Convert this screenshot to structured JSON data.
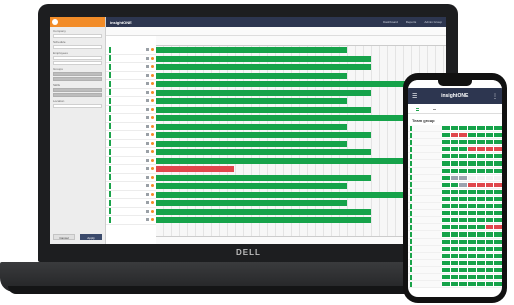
{
  "laptop": {
    "brand": "DELL",
    "left_panel": {
      "labels": [
        "Company",
        "Schedule",
        "Employees",
        "Groups",
        "Skills",
        "Location"
      ],
      "buttons": {
        "cancel": "Cancel",
        "apply": "Apply"
      }
    },
    "topbar": {
      "title": "insightONE",
      "links": [
        "Dashboard",
        "Reports",
        "Admin Group"
      ]
    },
    "rows": [
      {
        "bar": 0.66
      },
      {
        "bar": 0.74
      },
      {
        "bar": 0.74
      },
      {
        "bar": 0.66
      },
      {
        "bar": 0.86
      },
      {
        "bar": 0.74
      },
      {
        "bar": 0.66
      },
      {
        "bar": 0.74
      },
      {
        "bar": 0.86
      },
      {
        "bar": 0.66
      },
      {
        "bar": 0.74
      },
      {
        "bar": 0.66
      },
      {
        "bar": 0.74
      },
      {
        "bar": 0.86
      },
      {
        "bar": 0.27,
        "red": true
      },
      {
        "bar": 0.74
      },
      {
        "bar": 0.66
      },
      {
        "bar": 0.86
      },
      {
        "bar": 0.66
      },
      {
        "bar": 0.74
      },
      {
        "bar": 0.74
      }
    ],
    "colors": {
      "ok": "#16a34a",
      "alert": "#e0474c",
      "header": "#2d3650",
      "accent": "#f28c28"
    }
  },
  "phone": {
    "title": "insightONE",
    "section": "Team group",
    "rows": [
      [
        "g",
        "g",
        "g",
        "g",
        "g",
        "g",
        "g"
      ],
      [
        "g",
        "r",
        "r",
        "g",
        "g",
        "g",
        "g"
      ],
      [
        "g",
        "g",
        "g",
        "g",
        "g",
        "g",
        "g"
      ],
      [
        "g",
        "g",
        "g",
        "r",
        "r",
        "r",
        "r"
      ],
      [
        "g",
        "g",
        "g",
        "g",
        "g",
        "g",
        "g"
      ],
      [
        "g",
        "g",
        "g",
        "g",
        "g",
        "g",
        "g"
      ],
      [
        "g",
        "g",
        "g",
        "g",
        "g",
        "g",
        "g"
      ],
      [
        "g",
        "y",
        "y",
        "e",
        "e",
        "e",
        "e"
      ],
      [
        "g",
        "g",
        "y",
        "r",
        "r",
        "r",
        "r"
      ],
      [
        "g",
        "g",
        "g",
        "g",
        "g",
        "g",
        "g"
      ],
      [
        "g",
        "g",
        "g",
        "g",
        "g",
        "g",
        "g"
      ],
      [
        "g",
        "g",
        "g",
        "g",
        "g",
        "g",
        "g"
      ],
      [
        "g",
        "g",
        "g",
        "g",
        "g",
        "g",
        "g"
      ],
      [
        "g",
        "g",
        "g",
        "g",
        "g",
        "g",
        "g"
      ],
      [
        "g",
        "g",
        "g",
        "g",
        "g",
        "r",
        "r"
      ],
      [
        "g",
        "g",
        "g",
        "g",
        "g",
        "g",
        "g"
      ],
      [
        "g",
        "g",
        "g",
        "g",
        "g",
        "g",
        "g"
      ],
      [
        "g",
        "g",
        "g",
        "g",
        "g",
        "g",
        "g"
      ],
      [
        "g",
        "g",
        "g",
        "g",
        "g",
        "g",
        "g"
      ],
      [
        "g",
        "g",
        "g",
        "g",
        "g",
        "g",
        "g"
      ],
      [
        "g",
        "g",
        "g",
        "g",
        "g",
        "g",
        "g"
      ],
      [
        "g",
        "g",
        "g",
        "g",
        "g",
        "g",
        "g"
      ],
      [
        "g",
        "g",
        "g",
        "g",
        "g",
        "g",
        "g"
      ]
    ]
  }
}
